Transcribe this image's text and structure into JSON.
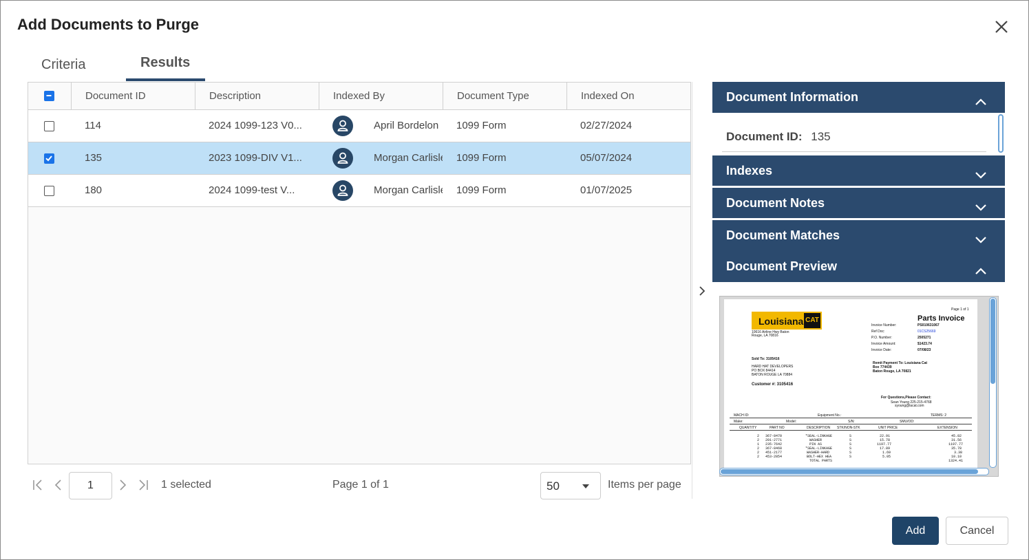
{
  "dialog": {
    "title": "Add Documents to Purge"
  },
  "tabs": [
    {
      "label": "Criteria",
      "active": false
    },
    {
      "label": "Results",
      "active": true
    }
  ],
  "grid": {
    "columns": [
      "Document ID",
      "Description",
      "Indexed By",
      "Document Type",
      "Indexed On"
    ],
    "header_checkbox_state": "partial",
    "rows": [
      {
        "checked": false,
        "selected": false,
        "document_id": "114",
        "description": "2024 1099-123 V0...",
        "indexed_by": "April Bordelon",
        "document_type": "1099 Form",
        "indexed_on": "02/27/2024"
      },
      {
        "checked": true,
        "selected": true,
        "document_id": "135",
        "description": "2023 1099-DIV V1...",
        "indexed_by": "Morgan Carlisle",
        "document_type": "1099 Form",
        "indexed_on": "05/07/2024"
      },
      {
        "checked": false,
        "selected": false,
        "document_id": "180",
        "description": "2024 1099-test V...",
        "indexed_by": "Morgan Carlisle",
        "document_type": "1099 Form",
        "indexed_on": "01/07/2025"
      }
    ]
  },
  "pager": {
    "current_page": "1",
    "selected_text": "1 selected",
    "page_of": "Page 1 of 1",
    "items_per_page": "50",
    "items_per_page_label": "Items per page"
  },
  "panels": {
    "document_information": {
      "label": "Document Information",
      "expanded": true,
      "field_label": "Document ID:",
      "field_value": "135"
    },
    "indexes": {
      "label": "Indexes",
      "expanded": false
    },
    "document_notes": {
      "label": "Document Notes",
      "expanded": false
    },
    "document_matches": {
      "label": "Document Matches",
      "expanded": false
    },
    "document_preview": {
      "label": "Document Preview",
      "expanded": true
    }
  },
  "preview": {
    "page_no": "Page 1 of 1",
    "logo_text": "Louisiana",
    "logo_badge": "CAT",
    "doc_title": "Parts Invoice",
    "address": [
      "10616 Airline Hwy Baton",
      "Rouge, LA 70816"
    ],
    "meta_labels": [
      "Invoice Number:",
      "Ref Doc:",
      "P.O. Number:",
      "Invoice Amount:",
      "Invoice Date:"
    ],
    "meta_values": [
      "PS010631067",
      "01CS25669",
      "2505271",
      "$1423.74",
      "07/08/23"
    ],
    "sold_to": "Sold To: 3105416",
    "sold_lines": [
      "HARD HAT DEVELOPERS",
      "PO BOX 84414",
      "BATON ROUGE LA 70884"
    ],
    "customer": "Customer #: 3105416",
    "remit": [
      "Remit Payment To: Louisiana Cat",
      "Box 774439",
      "Baton Rouge, LA 70821"
    ],
    "contact": [
      "For Questions,Please Contact:",
      "Sean Young 225-215-4768",
      "syoung@lacat.com"
    ],
    "row1": [
      "MACH ID:",
      "Equipment No.:",
      "TERMS:  2"
    ],
    "row2": [
      "Make:",
      "Model:",
      "S/N:",
      "SMU/OD:"
    ],
    "table_headers": [
      "QUANTITY",
      "PART NO",
      "DESCRIPTION",
      "STK/NON-STK",
      "UNIT PRICE",
      "EXTENSION"
    ],
    "table_rows": [
      [
        "2",
        "367-8470",
        "*SEAL-LINKAGE",
        "S",
        "22.91",
        "45.82"
      ],
      [
        "2",
        "201-2771",
        "WASHER",
        "S",
        "15.78",
        "31.56"
      ],
      [
        "1",
        "235-7642",
        "PIN AS",
        "S",
        "1197.77",
        "1197.77"
      ],
      [
        "2",
        "367-8468",
        "*SEAL-LINKAGE",
        "S",
        "17.89",
        "35.78"
      ],
      [
        "2",
        "451-2177",
        "WASHER-HARD",
        "S",
        "1.69",
        "3.38"
      ],
      [
        "2",
        "453-2854",
        "BOLT-HEX HEA",
        "S",
        "5.05",
        "10.10"
      ],
      [
        "",
        "",
        "TOTAL PARTS",
        "",
        "",
        "1324.41"
      ]
    ]
  },
  "buttons": {
    "add": "Add",
    "cancel": "Cancel"
  }
}
